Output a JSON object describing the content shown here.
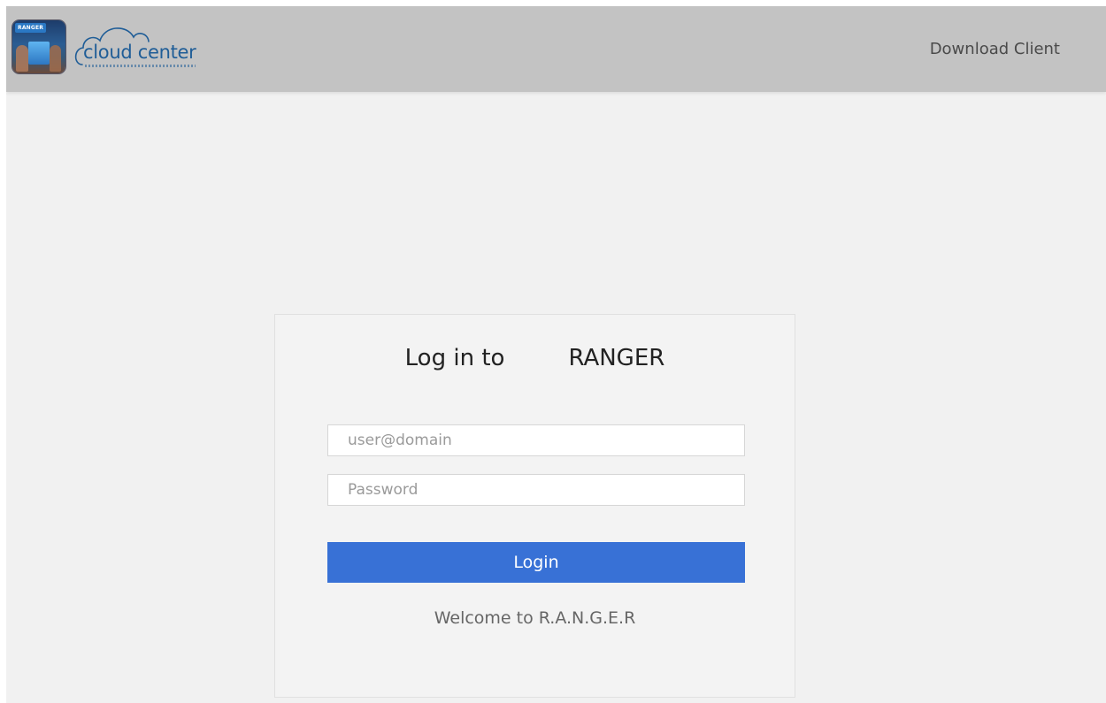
{
  "header": {
    "app_icon_badge": "RANGER",
    "logo_text": "cloud center",
    "download_link": "Download Client"
  },
  "login_card": {
    "title_prefix": "Log in to",
    "title_brand": "RANGER",
    "username_placeholder": "user@domain",
    "password_placeholder": "Password",
    "login_button": "Login",
    "welcome_text": "Welcome to R.A.N.G.E.R"
  },
  "colors": {
    "topbar_bg": "#c3c3c3",
    "page_bg": "#f1f1f1",
    "button_bg": "#3871d6",
    "logo_blue": "#1f5d97"
  }
}
